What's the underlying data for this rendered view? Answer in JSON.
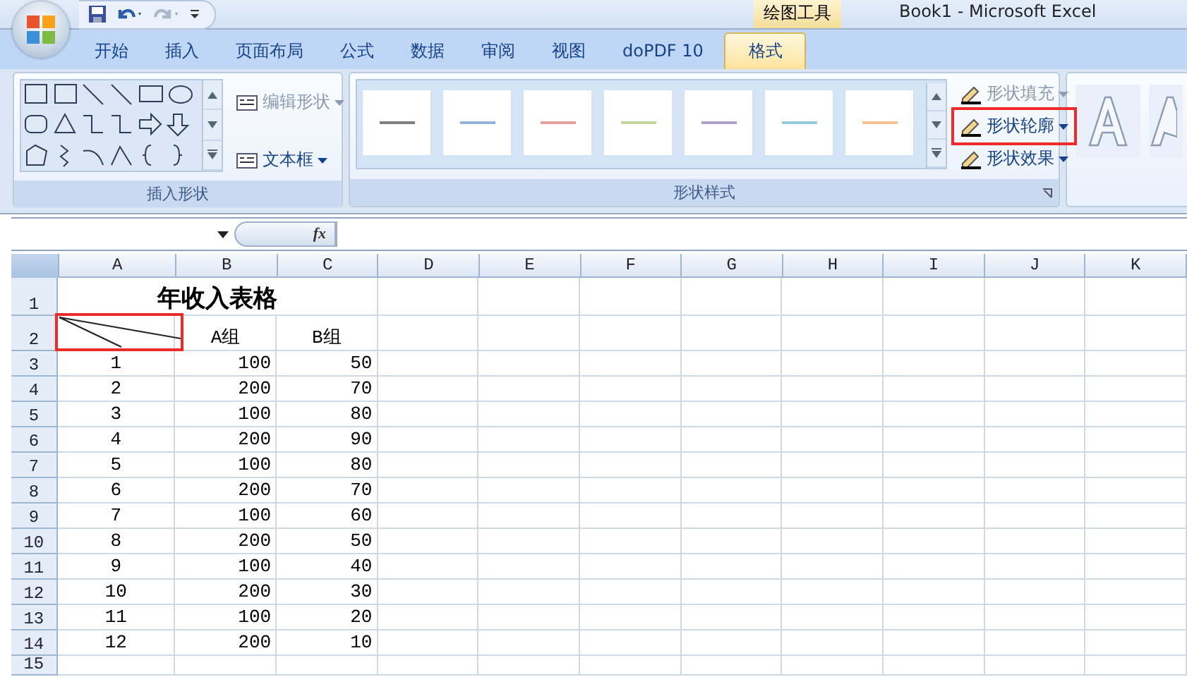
{
  "title_bar": {
    "context_tab": "绘图工具",
    "title": "Book1 - Microsoft Excel"
  },
  "tabs": [
    {
      "label": "开始",
      "selected": false
    },
    {
      "label": "插入",
      "selected": false
    },
    {
      "label": "页面布局",
      "selected": false
    },
    {
      "label": "公式",
      "selected": false
    },
    {
      "label": "数据",
      "selected": false
    },
    {
      "label": "审阅",
      "selected": false
    },
    {
      "label": "视图",
      "selected": false
    },
    {
      "label": "doPDF 10",
      "selected": false
    },
    {
      "label": "格式",
      "selected": true
    }
  ],
  "ribbon": {
    "groups": [
      {
        "kind": "shapes",
        "label": "插入形状",
        "buttons": [
          {
            "label": "编辑形状",
            "disabled": true
          },
          {
            "label": "文本框",
            "disabled": false
          }
        ]
      },
      {
        "kind": "styles",
        "label": "形状样式",
        "swatches": [
          {
            "color": "#7f7f7f"
          },
          {
            "color": "#95b3d7"
          },
          {
            "color": "#e6a0a0"
          },
          {
            "color": "#c3d69b"
          },
          {
            "color": "#b3a2c7"
          },
          {
            "color": "#93cddd"
          },
          {
            "color": "#fac08f"
          }
        ],
        "buttons": [
          {
            "label": "形状填充",
            "disabled": true,
            "highlighted": false
          },
          {
            "label": "形状轮廓",
            "disabled": false,
            "highlighted": true
          },
          {
            "label": "形状效果",
            "disabled": false,
            "highlighted": false
          }
        ]
      },
      {
        "kind": "wordart"
      }
    ]
  },
  "formula_bar": {
    "fx": "fx"
  },
  "sheet": {
    "columns": [
      "A",
      "B",
      "C",
      "D",
      "E",
      "F",
      "G",
      "H",
      "I",
      "J",
      "K"
    ],
    "row_numbers": [
      "1",
      "2",
      "3",
      "4",
      "5",
      "6",
      "7",
      "8",
      "9",
      "10",
      "11",
      "12",
      "13",
      "14",
      "15"
    ],
    "title": "年收入表格",
    "corner_cell": {
      "highlighted": true
    },
    "headers": [
      "A组",
      "B组"
    ],
    "rows": [
      [
        "1",
        "100",
        "50"
      ],
      [
        "2",
        "200",
        "70"
      ],
      [
        "3",
        "100",
        "80"
      ],
      [
        "4",
        "200",
        "90"
      ],
      [
        "5",
        "100",
        "80"
      ],
      [
        "6",
        "200",
        "70"
      ],
      [
        "7",
        "100",
        "60"
      ],
      [
        "8",
        "200",
        "50"
      ],
      [
        "9",
        "100",
        "40"
      ],
      [
        "10",
        "200",
        "30"
      ],
      [
        "11",
        "100",
        "20"
      ],
      [
        "12",
        "200",
        "10"
      ]
    ]
  }
}
